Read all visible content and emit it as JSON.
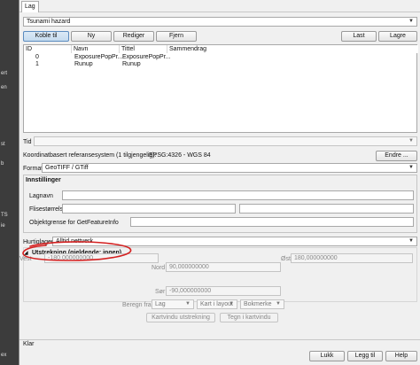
{
  "dialog": {
    "tab_label": "Lag",
    "layer_select": "Tsunami hazard",
    "buttons": {
      "connect": "Koble til",
      "new": "Ny",
      "edit": "Rediger",
      "remove": "Fjern",
      "load": "Last",
      "save": "Lagre"
    },
    "table": {
      "headers": [
        "ID",
        "Navn",
        "Tittel",
        "Sammendrag"
      ],
      "rows": [
        {
          "id": "0",
          "name": "ExposurePopPr...",
          "title": "ExposurePopPr...",
          "summary": ""
        },
        {
          "id": "1",
          "name": "Runup",
          "title": "Runup",
          "summary": ""
        }
      ]
    },
    "time_label": "Tid",
    "crs_label": "Koordinatbasert referansesystem (1 tilgjengelig):",
    "crs_value": "EPSG:4326 - WGS 84",
    "change_button": "Endre ...",
    "format_label": "Format",
    "format_value": "GeoTIFF / GTiff",
    "settings": {
      "title": "Innstillinger",
      "layer_name_label": "Lagnavn",
      "tile_size_label": "Flisestørrelse",
      "object_limit_label": "Objektgrense for GetFeatureInfo"
    },
    "quick_zoom_label": "Hurtiglager",
    "quick_zoom_value": "Alltid nettverk",
    "extent": {
      "title": "Utstrekning (gjeldende: ingen)",
      "north_label": "Nord",
      "north_value": "90,000000000",
      "west_label": "Vest",
      "west_value": "-180,000000000",
      "east_label": "Øst",
      "east_value": "180,000000000",
      "south_label": "Sør",
      "south_value": "-90,000000000",
      "compute_from_label": "Beregn fra",
      "layer_combo": "Lag",
      "map_layout_combo": "Kart i layout",
      "bookmark_combo": "Bokmerke",
      "map_canvas_button": "Kartvindu utstrekning",
      "draw_button": "Tegn i kartvindu"
    },
    "status_text": "Klar",
    "footer": {
      "close": "Lukk",
      "add": "Legg til",
      "help": "Help"
    }
  },
  "left_strip_marks": [
    "",
    "ert",
    "en",
    "st",
    "b",
    "TS",
    "ie",
    "ex"
  ],
  "colors": {
    "annotation_red": "#d42020",
    "selected_button": "#c5dbef"
  }
}
